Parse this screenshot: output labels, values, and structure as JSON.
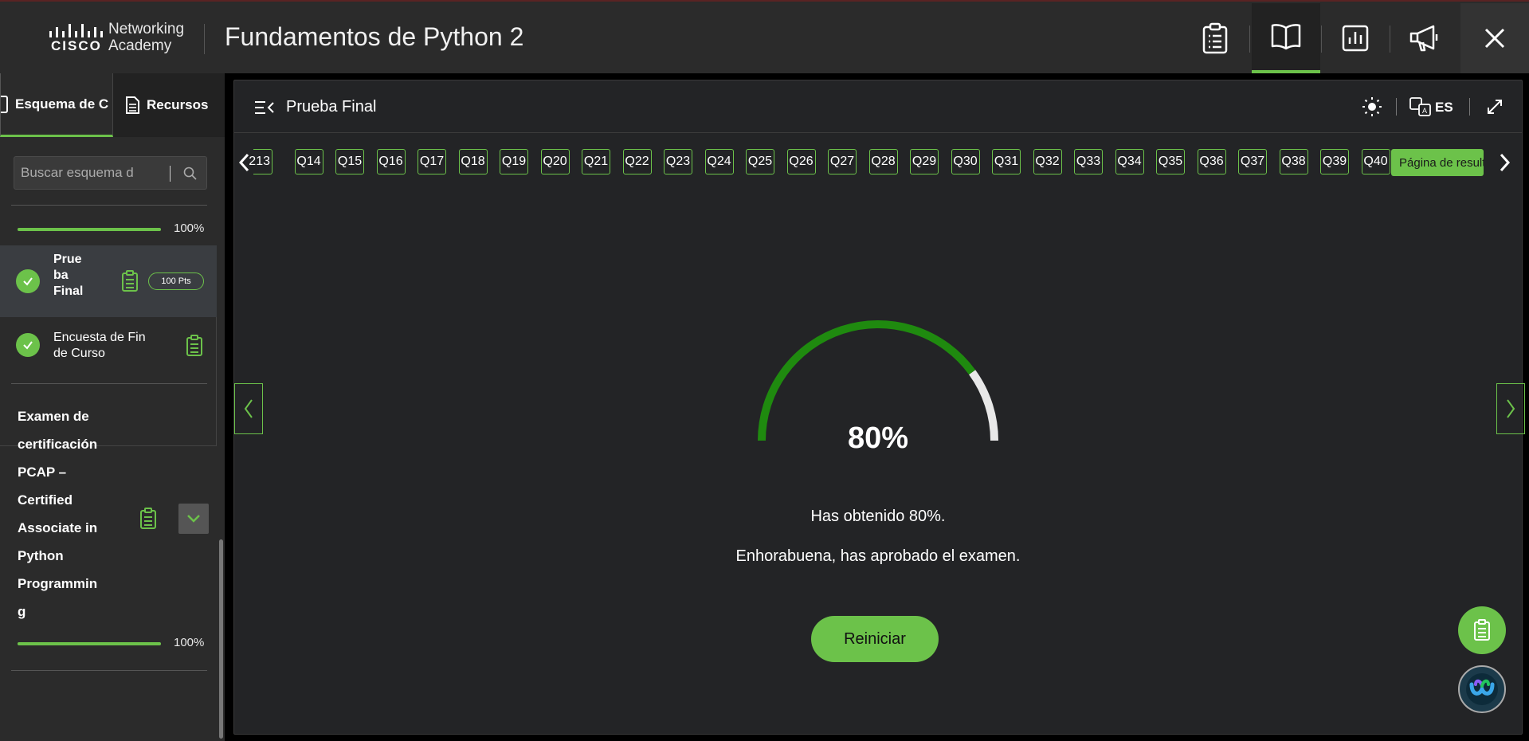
{
  "header": {
    "logo_text_line1": "Networking",
    "logo_text_line2": "Academy",
    "logo_brand": "CISCO",
    "course_title": "Fundamentos de Python 2",
    "buttons": [
      {
        "name": "clipboard-icon"
      },
      {
        "name": "book-icon",
        "active": true
      },
      {
        "name": "bar-chart-icon"
      },
      {
        "name": "megaphone-icon"
      },
      {
        "name": "close-icon"
      }
    ]
  },
  "sidebar": {
    "tabs": [
      {
        "label": "Esquema de C",
        "icon": "outline-icon"
      },
      {
        "label": "Recursos",
        "icon": "document-icon"
      }
    ],
    "search": {
      "placeholder": "Buscar esquema d"
    },
    "section_progress": {
      "percent_label": "100%",
      "value": 1.0
    },
    "items": [
      {
        "label_lines": [
          "Prue",
          "ba",
          "Final"
        ],
        "completed": true,
        "points": "100 Pts",
        "selected": true
      },
      {
        "label_lines": [
          "Encuesta de Fin",
          "de Curso"
        ],
        "completed": true
      }
    ],
    "exam": {
      "title_lines": [
        "Examen de",
        "certificación",
        "PCAP –",
        "Certified",
        "Associate in",
        "Python",
        "Programmin",
        "g"
      ],
      "progress_label": "100%",
      "progress_value": 1.0
    }
  },
  "main": {
    "title": "Prueba Final",
    "language": "ES",
    "questions": [
      "213",
      "Q14",
      "Q15",
      "Q16",
      "Q17",
      "Q18",
      "Q19",
      "Q20",
      "Q21",
      "Q22",
      "Q23",
      "Q24",
      "Q25",
      "Q26",
      "Q27",
      "Q28",
      "Q29",
      "Q30",
      "Q31",
      "Q32",
      "Q33",
      "Q34",
      "Q35",
      "Q36",
      "Q37",
      "Q38",
      "Q39",
      "Q40"
    ],
    "result_tab": "Página de resultados",
    "score": {
      "value": 0.8,
      "label": "80%",
      "line1": "Has obtenido 80%.",
      "line2": "Enhorabuena, has aprobado el examen."
    },
    "restart_label": "Reiniciar"
  },
  "colors": {
    "accent": "#6cc24a",
    "gauge_fill": "#1f8a0f",
    "gauge_rest": "#e8e8e8",
    "panel": "#232426",
    "header": "#2b2b2b"
  }
}
